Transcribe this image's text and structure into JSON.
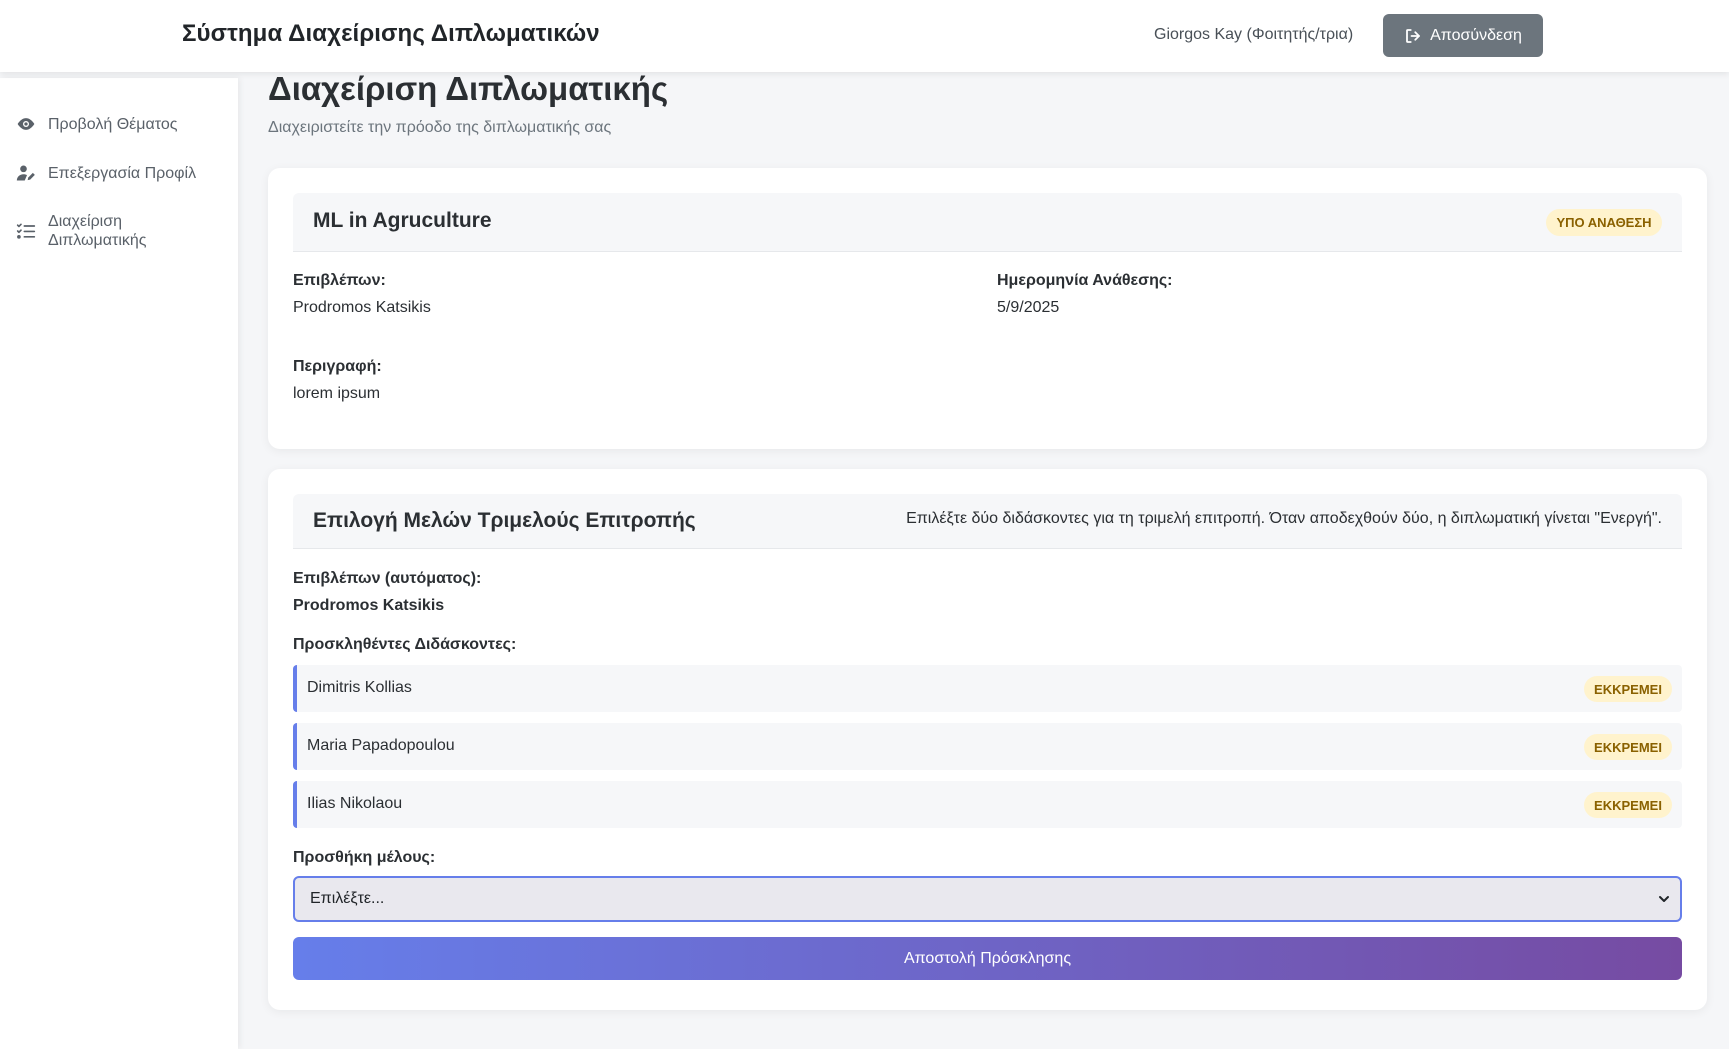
{
  "header": {
    "app_title": "Σύστημα Διαχείρισης Διπλωματικών",
    "user_name": "Giorgos Kay (Φοιτητής/τρια)",
    "logout_label": "Αποσύνδεση"
  },
  "sidebar": {
    "items": [
      {
        "label": "Προβολή Θέματος",
        "icon": "eye-icon"
      },
      {
        "label": "Επεξεργασία Προφίλ",
        "icon": "user-edit-icon"
      },
      {
        "label": "Διαχείριση Διπλωματικής",
        "icon": "checklist-icon"
      }
    ]
  },
  "page": {
    "title": "Διαχείριση Διπλωματικής",
    "subtitle": "Διαχειριστείτε την πρόοδο της διπλωματικής σας"
  },
  "thesis": {
    "title": "ML in Agruculture",
    "status": "ΥΠΟ ΑΝΑΘΕΣΗ",
    "supervisor_label": "Επιβλέπων:",
    "supervisor": "Prodromos Katsikis",
    "date_label": "Ημερομηνία Ανάθεσης:",
    "date": "5/9/2025",
    "description_label": "Περιγραφή:",
    "description": "lorem ipsum"
  },
  "committee": {
    "title": "Επιλογή Μελών Τριμελούς Επιτροπής",
    "note": "Επιλέξτε δύο διδάσκοντες για τη τριμελή επιτροπή. Όταν αποδεχθούν δύο, η διπλωματική γίνεται \"Ενεργή\".",
    "supervisor_label": "Επιβλέπων (αυτόματος):",
    "supervisor": "Prodromos Katsikis",
    "invited_label": "Προσκληθέντες Διδάσκοντες:",
    "invited": [
      {
        "name": "Dimitris Kollias",
        "status": "ΕΚΚΡΕΜΕΙ"
      },
      {
        "name": "Maria Papadopoulou",
        "status": "ΕΚΚΡΕΜΕΙ"
      },
      {
        "name": "Ilias Nikolaou",
        "status": "ΕΚΚΡΕΜΕΙ"
      }
    ],
    "add_label": "Προσθήκη μέλους:",
    "select_value": "Επιλέξτε...",
    "send_label": "Αποστολή Πρόσκλησης"
  },
  "colors": {
    "accent_start": "#667eea",
    "accent_end": "#764ba2",
    "logout_bg": "#6c757d",
    "badge_bg": "#fff3cd",
    "badge_text": "#8a6100"
  }
}
